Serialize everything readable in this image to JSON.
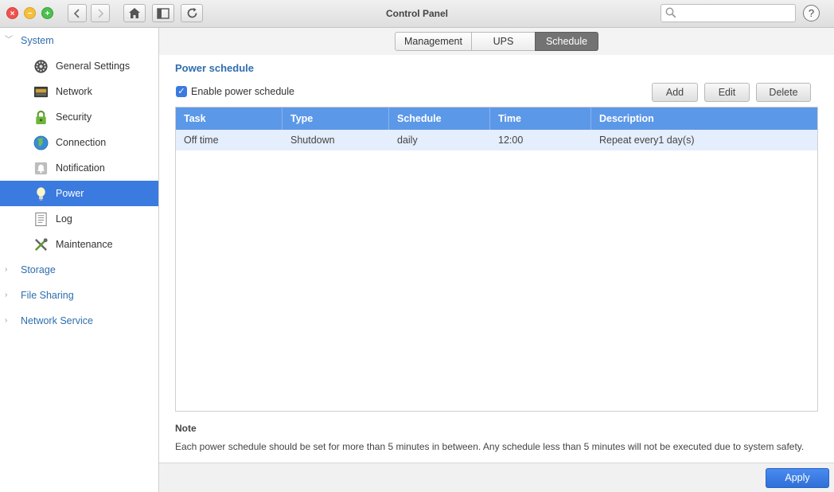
{
  "window": {
    "title": "Control Panel"
  },
  "search": {
    "placeholder": ""
  },
  "sidebar": {
    "sections": [
      {
        "label": "System",
        "expanded": true
      },
      {
        "label": "Storage",
        "expanded": false
      },
      {
        "label": "File Sharing",
        "expanded": false
      },
      {
        "label": "Network Service",
        "expanded": false
      }
    ],
    "system_items": [
      {
        "label": "General Settings",
        "icon": "gear-icon"
      },
      {
        "label": "Network",
        "icon": "network-icon"
      },
      {
        "label": "Security",
        "icon": "lock-icon"
      },
      {
        "label": "Connection",
        "icon": "globe-icon"
      },
      {
        "label": "Notification",
        "icon": "bell-icon"
      },
      {
        "label": "Power",
        "icon": "lightbulb-icon",
        "active": true
      },
      {
        "label": "Log",
        "icon": "log-icon"
      },
      {
        "label": "Maintenance",
        "icon": "wrench-icon"
      }
    ]
  },
  "tabs": [
    {
      "label": "Management"
    },
    {
      "label": "UPS"
    },
    {
      "label": "Schedule",
      "active": true
    }
  ],
  "schedule": {
    "title": "Power schedule",
    "enable_label": "Enable power schedule",
    "enabled": true,
    "buttons": {
      "add": "Add",
      "edit": "Edit",
      "delete": "Delete"
    },
    "columns": [
      "Task",
      "Type",
      "Schedule",
      "Time",
      "Description"
    ],
    "rows": [
      {
        "task": "Off time",
        "type": "Shutdown",
        "schedule": "daily",
        "time": "12:00",
        "description": "Repeat every1 day(s)"
      }
    ]
  },
  "note": {
    "title": "Note",
    "text": "Each power schedule should be set for more than 5 minutes in between. Any schedule less than 5 minutes will not be executed due to system safety."
  },
  "footer": {
    "apply_label": "Apply"
  },
  "colors": {
    "accent": "#3b7be0",
    "header_blue": "#5c98e8",
    "link_blue": "#2f6ead",
    "selected_row": "#e4eefc"
  }
}
